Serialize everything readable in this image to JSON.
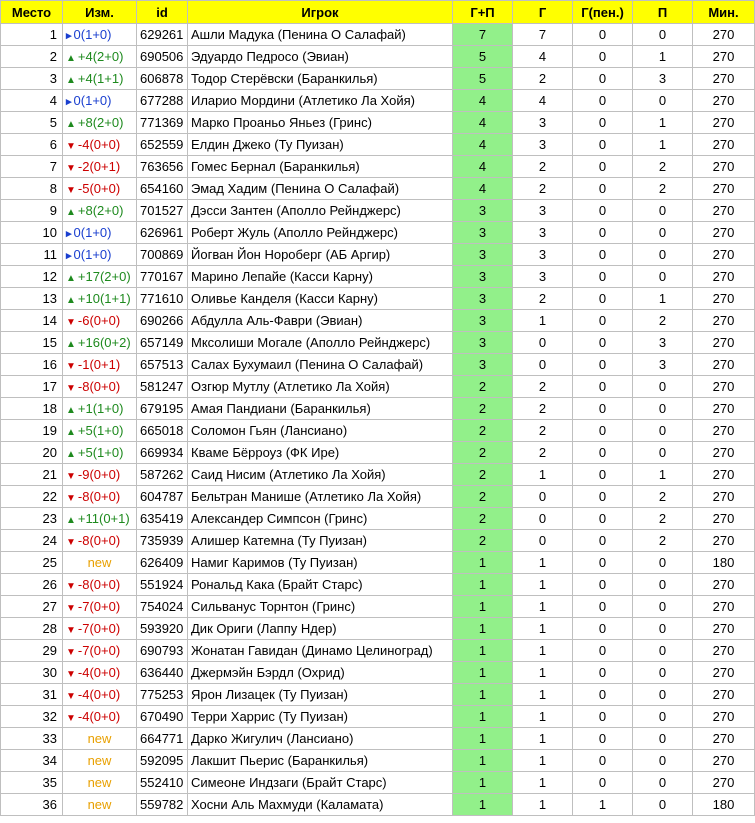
{
  "colors": {
    "header_bg": "#ffff00",
    "gp_bg": "#92f08a",
    "up": "#1e8a1e",
    "down": "#cc0000",
    "same": "#1a3fcf",
    "new": "#e8a000"
  },
  "headers": {
    "place": "Место",
    "change": "Изм.",
    "id": "id",
    "player": "Игрок",
    "gp": "Г+П",
    "g": "Г",
    "gpen": "Г(пен.)",
    "p": "П",
    "min": "Мин."
  },
  "rows": [
    {
      "place": "1",
      "dir": "same",
      "change": "0(1+0)",
      "id": "629261",
      "player": "Ашли Мадука (Пенина О Салафай)",
      "gp": "7",
      "g": "7",
      "gpen": "0",
      "p": "0",
      "min": "270"
    },
    {
      "place": "2",
      "dir": "up",
      "change": "+4(2+0)",
      "id": "690506",
      "player": "Эдуардо Педросо (Эвиан)",
      "gp": "5",
      "g": "4",
      "gpen": "0",
      "p": "1",
      "min": "270"
    },
    {
      "place": "3",
      "dir": "up",
      "change": "+4(1+1)",
      "id": "606878",
      "player": "Тодор Стерёвски (Баранкилья)",
      "gp": "5",
      "g": "2",
      "gpen": "0",
      "p": "3",
      "min": "270"
    },
    {
      "place": "4",
      "dir": "same",
      "change": "0(1+0)",
      "id": "677288",
      "player": "Иларио Мордини (Атлетико Ла Хойя)",
      "gp": "4",
      "g": "4",
      "gpen": "0",
      "p": "0",
      "min": "270"
    },
    {
      "place": "5",
      "dir": "up",
      "change": "+8(2+0)",
      "id": "771369",
      "player": "Марко Проаньо Яньез (Гринс)",
      "gp": "4",
      "g": "3",
      "gpen": "0",
      "p": "1",
      "min": "270"
    },
    {
      "place": "6",
      "dir": "down",
      "change": "-4(0+0)",
      "id": "652559",
      "player": "Елдин Джеко (Ту Пуизан)",
      "gp": "4",
      "g": "3",
      "gpen": "0",
      "p": "1",
      "min": "270"
    },
    {
      "place": "7",
      "dir": "down",
      "change": "-2(0+1)",
      "id": "763656",
      "player": "Гомес Бернал (Баранкилья)",
      "gp": "4",
      "g": "2",
      "gpen": "0",
      "p": "2",
      "min": "270"
    },
    {
      "place": "8",
      "dir": "down",
      "change": "-5(0+0)",
      "id": "654160",
      "player": "Эмад Хадим (Пенина О Салафай)",
      "gp": "4",
      "g": "2",
      "gpen": "0",
      "p": "2",
      "min": "270"
    },
    {
      "place": "9",
      "dir": "up",
      "change": "+8(2+0)",
      "id": "701527",
      "player": "Дэсси Зантен (Аполло Рейнджерс)",
      "gp": "3",
      "g": "3",
      "gpen": "0",
      "p": "0",
      "min": "270"
    },
    {
      "place": "10",
      "dir": "same",
      "change": "0(1+0)",
      "id": "626961",
      "player": "Роберт Жуль (Аполло Рейнджерс)",
      "gp": "3",
      "g": "3",
      "gpen": "0",
      "p": "0",
      "min": "270"
    },
    {
      "place": "11",
      "dir": "same",
      "change": "0(1+0)",
      "id": "700869",
      "player": "Йогван Йон Нороберг (АБ Аргир)",
      "gp": "3",
      "g": "3",
      "gpen": "0",
      "p": "0",
      "min": "270"
    },
    {
      "place": "12",
      "dir": "up",
      "change": "+17(2+0)",
      "id": "770167",
      "player": "Марино Лепайе (Касси Карну)",
      "gp": "3",
      "g": "3",
      "gpen": "0",
      "p": "0",
      "min": "270"
    },
    {
      "place": "13",
      "dir": "up",
      "change": "+10(1+1)",
      "id": "771610",
      "player": "Оливье Канделя (Касси Карну)",
      "gp": "3",
      "g": "2",
      "gpen": "0",
      "p": "1",
      "min": "270"
    },
    {
      "place": "14",
      "dir": "down",
      "change": "-6(0+0)",
      "id": "690266",
      "player": "Абдулла Аль-Фаври (Эвиан)",
      "gp": "3",
      "g": "1",
      "gpen": "0",
      "p": "2",
      "min": "270"
    },
    {
      "place": "15",
      "dir": "up",
      "change": "+16(0+2)",
      "id": "657149",
      "player": "Мксолиши Могале (Аполло Рейнджерс)",
      "gp": "3",
      "g": "0",
      "gpen": "0",
      "p": "3",
      "min": "270"
    },
    {
      "place": "16",
      "dir": "down",
      "change": "-1(0+1)",
      "id": "657513",
      "player": "Салах Бухумаил (Пенина О Салафай)",
      "gp": "3",
      "g": "0",
      "gpen": "0",
      "p": "3",
      "min": "270"
    },
    {
      "place": "17",
      "dir": "down",
      "change": "-8(0+0)",
      "id": "581247",
      "player": "Озгюр Мутлу (Атлетико Ла Хойя)",
      "gp": "2",
      "g": "2",
      "gpen": "0",
      "p": "0",
      "min": "270"
    },
    {
      "place": "18",
      "dir": "up",
      "change": "+1(1+0)",
      "id": "679195",
      "player": "Амая Пандиани (Баранкилья)",
      "gp": "2",
      "g": "2",
      "gpen": "0",
      "p": "0",
      "min": "270"
    },
    {
      "place": "19",
      "dir": "up",
      "change": "+5(1+0)",
      "id": "665018",
      "player": "Соломон Гьян (Лансиано)",
      "gp": "2",
      "g": "2",
      "gpen": "0",
      "p": "0",
      "min": "270"
    },
    {
      "place": "20",
      "dir": "up",
      "change": "+5(1+0)",
      "id": "669934",
      "player": "Кваме Бёрроуз (ФК Ире)",
      "gp": "2",
      "g": "2",
      "gpen": "0",
      "p": "0",
      "min": "270"
    },
    {
      "place": "21",
      "dir": "down",
      "change": "-9(0+0)",
      "id": "587262",
      "player": "Саид Нисим (Атлетико Ла Хойя)",
      "gp": "2",
      "g": "1",
      "gpen": "0",
      "p": "1",
      "min": "270"
    },
    {
      "place": "22",
      "dir": "down",
      "change": "-8(0+0)",
      "id": "604787",
      "player": "Бельтран Манише (Атлетико Ла Хойя)",
      "gp": "2",
      "g": "0",
      "gpen": "0",
      "p": "2",
      "min": "270"
    },
    {
      "place": "23",
      "dir": "up",
      "change": "+11(0+1)",
      "id": "635419",
      "player": "Александер Симпсон (Гринс)",
      "gp": "2",
      "g": "0",
      "gpen": "0",
      "p": "2",
      "min": "270"
    },
    {
      "place": "24",
      "dir": "down",
      "change": "-8(0+0)",
      "id": "735939",
      "player": "Алишер Катемна (Ту Пуизан)",
      "gp": "2",
      "g": "0",
      "gpen": "0",
      "p": "2",
      "min": "270"
    },
    {
      "place": "25",
      "dir": "new",
      "change": "new",
      "id": "626409",
      "player": "Намиг Каримов (Ту Пуизан)",
      "gp": "1",
      "g": "1",
      "gpen": "0",
      "p": "0",
      "min": "180"
    },
    {
      "place": "26",
      "dir": "down",
      "change": "-8(0+0)",
      "id": "551924",
      "player": "Рональд Кака (Брайт Старс)",
      "gp": "1",
      "g": "1",
      "gpen": "0",
      "p": "0",
      "min": "270"
    },
    {
      "place": "27",
      "dir": "down",
      "change": "-7(0+0)",
      "id": "754024",
      "player": "Сильванус Торнтон (Гринс)",
      "gp": "1",
      "g": "1",
      "gpen": "0",
      "p": "0",
      "min": "270"
    },
    {
      "place": "28",
      "dir": "down",
      "change": "-7(0+0)",
      "id": "593920",
      "player": "Дик Ориги (Лаппу Ндер)",
      "gp": "1",
      "g": "1",
      "gpen": "0",
      "p": "0",
      "min": "270"
    },
    {
      "place": "29",
      "dir": "down",
      "change": "-7(0+0)",
      "id": "690793",
      "player": "Жонатан Гавидан (Динамо Целиноград)",
      "gp": "1",
      "g": "1",
      "gpen": "0",
      "p": "0",
      "min": "270"
    },
    {
      "place": "30",
      "dir": "down",
      "change": "-4(0+0)",
      "id": "636440",
      "player": "Джермэйн Бэрдл (Охрид)",
      "gp": "1",
      "g": "1",
      "gpen": "0",
      "p": "0",
      "min": "270"
    },
    {
      "place": "31",
      "dir": "down",
      "change": "-4(0+0)",
      "id": "775253",
      "player": "Ярон Лизацек (Ту Пуизан)",
      "gp": "1",
      "g": "1",
      "gpen": "0",
      "p": "0",
      "min": "270"
    },
    {
      "place": "32",
      "dir": "down",
      "change": "-4(0+0)",
      "id": "670490",
      "player": "Терри Харрис (Ту Пуизан)",
      "gp": "1",
      "g": "1",
      "gpen": "0",
      "p": "0",
      "min": "270"
    },
    {
      "place": "33",
      "dir": "new",
      "change": "new",
      "id": "664771",
      "player": "Дарко Жигулич (Лансиано)",
      "gp": "1",
      "g": "1",
      "gpen": "0",
      "p": "0",
      "min": "270"
    },
    {
      "place": "34",
      "dir": "new",
      "change": "new",
      "id": "592095",
      "player": "Лакшит Пьерис (Баранкилья)",
      "gp": "1",
      "g": "1",
      "gpen": "0",
      "p": "0",
      "min": "270"
    },
    {
      "place": "35",
      "dir": "new",
      "change": "new",
      "id": "552410",
      "player": "Симеоне Индзаги (Брайт Старс)",
      "gp": "1",
      "g": "1",
      "gpen": "0",
      "p": "0",
      "min": "270"
    },
    {
      "place": "36",
      "dir": "new",
      "change": "new",
      "id": "559782",
      "player": "Хосни Аль Махмуди (Каламата)",
      "gp": "1",
      "g": "1",
      "gpen": "1",
      "p": "0",
      "min": "180"
    }
  ]
}
